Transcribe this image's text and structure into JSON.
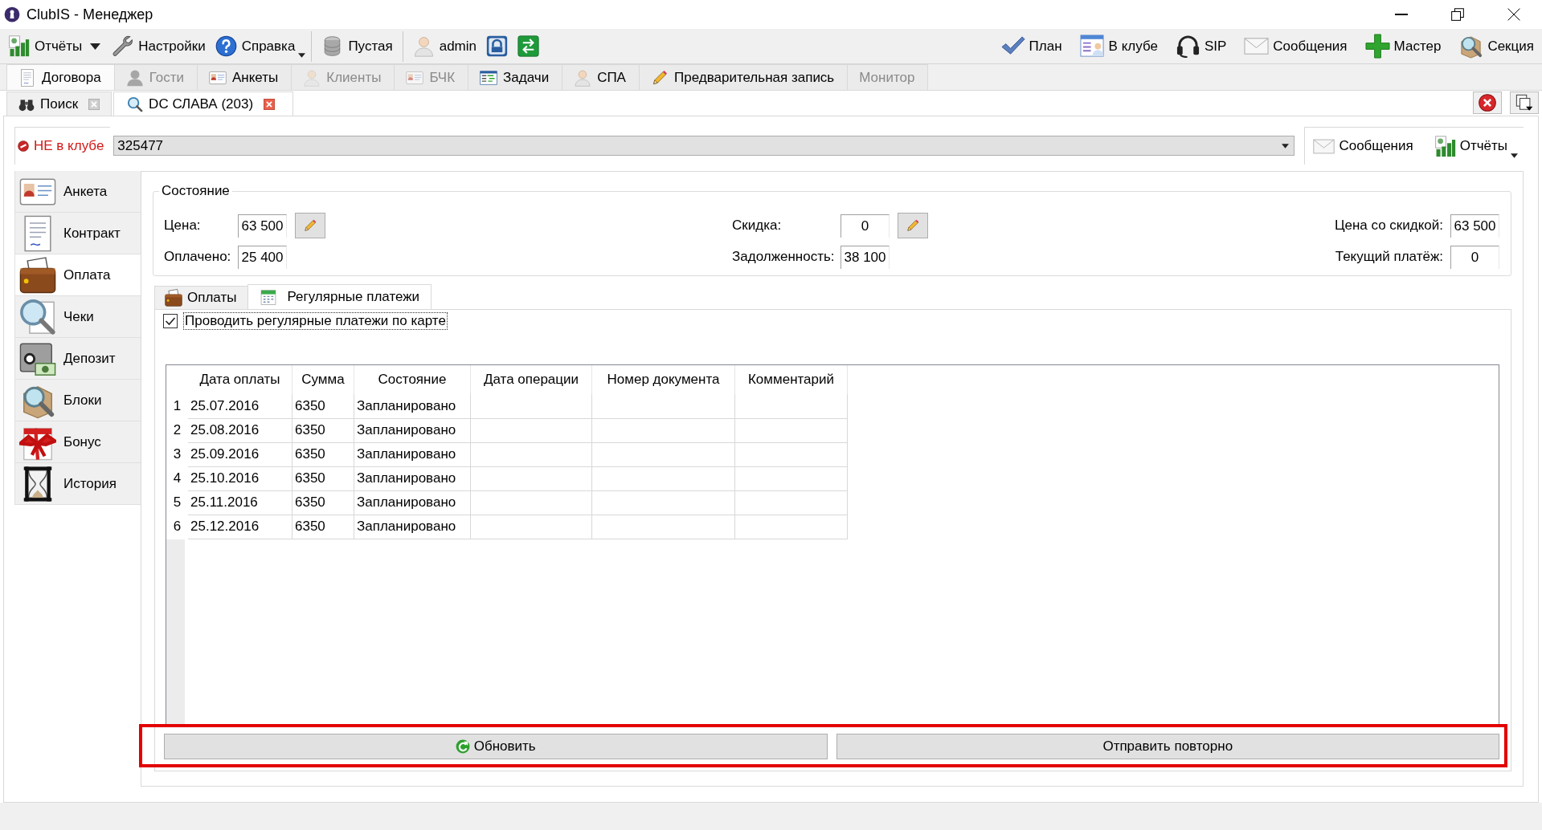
{
  "window": {
    "title": "ClubIS - Менеджер"
  },
  "toolbar": {
    "left": [
      {
        "label": "Отчёты",
        "kind": "split"
      },
      {
        "label": "Настройки",
        "kind": "plain"
      },
      {
        "label": "Справка",
        "kind": "menu"
      }
    ],
    "database": "Пустая",
    "user": "admin",
    "right": [
      "План",
      "В клубе",
      "SIP",
      "Сообщения",
      "Мастер",
      "Секция"
    ]
  },
  "main_tabs": [
    {
      "label": "Договора",
      "selected": true,
      "disabled": false
    },
    {
      "label": "Гости",
      "selected": false,
      "disabled": true
    },
    {
      "label": "Анкеты",
      "selected": false,
      "disabled": false
    },
    {
      "label": "Клиенты",
      "selected": false,
      "disabled": true
    },
    {
      "label": "БЧК",
      "selected": false,
      "disabled": true
    },
    {
      "label": "Задачи",
      "selected": false,
      "disabled": false
    },
    {
      "label": "СПА",
      "selected": false,
      "disabled": false
    },
    {
      "label": "Предварительная запись",
      "selected": false,
      "disabled": false
    },
    {
      "label": "Монитор",
      "selected": false,
      "disabled": true
    }
  ],
  "document_tabs": [
    {
      "label": "Поиск",
      "selected": false
    },
    {
      "label": "DC СЛАВА (203)",
      "selected": true
    }
  ],
  "client": {
    "status": "НЕ в клубе",
    "card_number": "325477",
    "buttons": [
      {
        "label": "Сообщения",
        "kind": "plain"
      },
      {
        "label": "Отчёты",
        "kind": "menu"
      }
    ]
  },
  "sidebar": {
    "items": [
      {
        "label": "Анкета",
        "selected": false
      },
      {
        "label": "Контракт",
        "selected": false
      },
      {
        "label": "Оплата",
        "selected": true
      },
      {
        "label": "Чеки",
        "selected": false
      },
      {
        "label": "Депозит",
        "selected": false
      },
      {
        "label": "Блоки",
        "selected": false
      },
      {
        "label": "Бонус",
        "selected": false
      },
      {
        "label": "История",
        "selected": false
      }
    ]
  },
  "status": {
    "title": "Состояние",
    "columns": [
      {
        "fields": [
          {
            "label": "Цена:",
            "value": "63 500",
            "editable": true
          },
          {
            "label": "Оплачено:",
            "value": "25 400",
            "editable": false
          }
        ]
      },
      {
        "fields": [
          {
            "label": "Скидка:",
            "value": "0",
            "editable": true
          },
          {
            "label": "Задолженность:",
            "value": "38 100",
            "editable": false
          }
        ]
      },
      {
        "fields": [
          {
            "label": "Цена со скидкой:",
            "value": "63 500",
            "editable": false
          },
          {
            "label": "Текущий платёж:",
            "value": "0",
            "editable": false
          }
        ]
      }
    ]
  },
  "payment_tabs": [
    {
      "label": "Оплаты",
      "selected": false
    },
    {
      "label": "Регулярные платежи",
      "selected": true
    }
  ],
  "auto_payment": {
    "label": "Проводить регулярные платежи по карте",
    "checked": true
  },
  "table": {
    "columns": [
      "Дата оплаты",
      "Сумма",
      "Состояние",
      "Дата операции",
      "Номер документа",
      "Комментарий"
    ],
    "rows": [
      {
        "number": "1",
        "cells": [
          "25.07.2016",
          "6350",
          "Запланировано"
        ]
      },
      {
        "number": "2",
        "cells": [
          "25.08.2016",
          "6350",
          "Запланировано"
        ]
      },
      {
        "number": "3",
        "cells": [
          "25.09.2016",
          "6350",
          "Запланировано"
        ]
      },
      {
        "number": "4",
        "cells": [
          "25.10.2016",
          "6350",
          "Запланировано"
        ]
      },
      {
        "number": "5",
        "cells": [
          "25.11.2016",
          "6350",
          "Запланировано"
        ]
      },
      {
        "number": "6",
        "cells": [
          "25.12.2016",
          "6350",
          "Запланировано"
        ]
      }
    ]
  },
  "actions": {
    "highlighted": true,
    "buttons": [
      "Обновить",
      "Отправить повторно"
    ]
  }
}
